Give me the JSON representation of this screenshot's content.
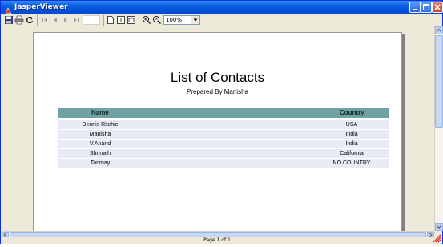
{
  "window": {
    "title": "JasperViewer",
    "brand_color": "#0a5fe0"
  },
  "toolbar": {
    "buttons": [
      {
        "name": "save-icon"
      },
      {
        "name": "print-icon"
      },
      {
        "name": "reload-icon"
      },
      {
        "name": "first-page-icon"
      },
      {
        "name": "previous-page-icon"
      },
      {
        "name": "next-page-icon"
      },
      {
        "name": "last-page-icon"
      },
      {
        "name": "actual-size-icon"
      },
      {
        "name": "fit-page-icon"
      },
      {
        "name": "fit-width-icon"
      },
      {
        "name": "zoom-in-icon"
      },
      {
        "name": "zoom-out-icon"
      }
    ],
    "page_number": "",
    "zoom": "100%"
  },
  "report": {
    "title": "List of Contacts",
    "subtitle": "Prepared By Manisha",
    "header_color": "#6fa3a3",
    "row_color": "#e6ebf4",
    "columns": [
      "Name",
      "Country"
    ],
    "rows": [
      {
        "name": "Dennis Ritchie",
        "country": "USA"
      },
      {
        "name": "Manisha",
        "country": "India"
      },
      {
        "name": "V.Anand",
        "country": "India"
      },
      {
        "name": "Shrinath",
        "country": "California"
      },
      {
        "name": "Tanmay",
        "country": "NO COUNTRY"
      }
    ]
  },
  "status": {
    "page_indicator": "Page 1 of 1"
  }
}
